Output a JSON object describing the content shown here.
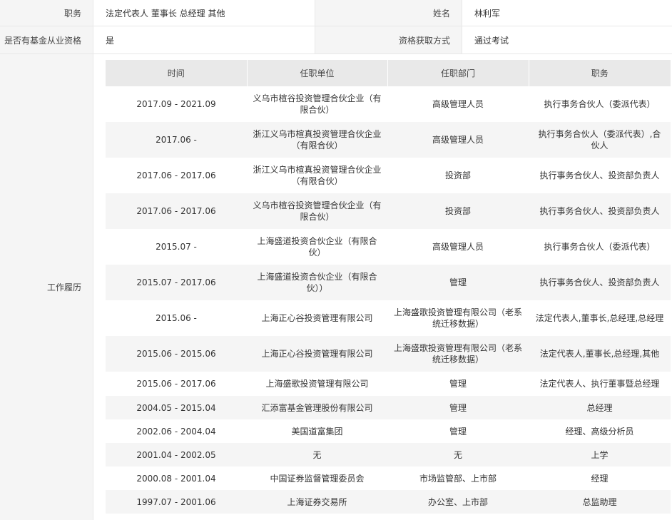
{
  "profile": {
    "position_label": "职务",
    "position_value": "法定代表人 董事长 总经理 其他",
    "name_label": "姓名",
    "name_value": "林利军",
    "qualification_label": "是否有基金从业资格",
    "qualification_value": "是",
    "method_label": "资格获取方式",
    "method_value": "通过考试",
    "history_label": "工作履历"
  },
  "history": {
    "headers": [
      "时间",
      "任职单位",
      "任职部门",
      "职务"
    ],
    "rows": [
      {
        "time": "2017.09 - 2021.09",
        "unit": "义乌市楦谷投资管理合伙企业（有限合伙）",
        "dept": "高级管理人员",
        "title": "执行事务合伙人（委派代表）"
      },
      {
        "time": "2017.06 -",
        "unit": "浙江义乌市楦真投资管理合伙企业（有限合伙）",
        "dept": "高级管理人员",
        "title": "执行事务合伙人（委派代表）,合伙人"
      },
      {
        "time": "2017.06 - 2017.06",
        "unit": "浙江义乌市楦真投资管理合伙企业（有限合伙）",
        "dept": "投资部",
        "title": "执行事务合伙人、投资部负责人"
      },
      {
        "time": "2017.06 - 2017.06",
        "unit": "义乌市楦谷投资管理合伙企业（有限合伙）",
        "dept": "投资部",
        "title": "执行事务合伙人、投资部负责人"
      },
      {
        "time": "2015.07 -",
        "unit": "上海盛道投资合伙企业（有限合伙）",
        "dept": "高级管理人员",
        "title": "执行事务合伙人（委派代表）"
      },
      {
        "time": "2015.07 - 2017.06",
        "unit": "上海盛道投资合伙企业（有限合伙））",
        "dept": "管理",
        "title": "执行事务合伙人、投资部负责人"
      },
      {
        "time": "2015.06 -",
        "unit": "上海正心谷投资管理有限公司",
        "dept": "上海盛歌投资管理有限公司（老系统迁移数据）",
        "title": "法定代表人,董事长,总经理,总经理"
      },
      {
        "time": "2015.06 - 2015.06",
        "unit": "上海正心谷投资管理有限公司",
        "dept": "上海盛歌投资管理有限公司（老系统迁移数据）",
        "title": "法定代表人,董事长,总经理,其他"
      },
      {
        "time": "2015.06 - 2017.06",
        "unit": "上海盛歌投资管理有限公司",
        "dept": "管理",
        "title": "法定代表人、执行董事暨总经理"
      },
      {
        "time": "2004.05 - 2015.04",
        "unit": "汇添富基金管理股份有限公司",
        "dept": "管理",
        "title": "总经理"
      },
      {
        "time": "2002.06 - 2004.04",
        "unit": "美国道富集团",
        "dept": "管理",
        "title": "经理、高级分析员"
      },
      {
        "time": "2001.04 - 2002.05",
        "unit": "无",
        "dept": "无",
        "title": "上学"
      },
      {
        "time": "2000.08 - 2001.04",
        "unit": "中国证券监督管理委员会",
        "dept": "市场监管部、上市部",
        "title": "经理"
      },
      {
        "time": "1997.07 - 2001.06",
        "unit": "上海证券交易所",
        "dept": "办公室、上市部",
        "title": "总监助理"
      }
    ]
  }
}
